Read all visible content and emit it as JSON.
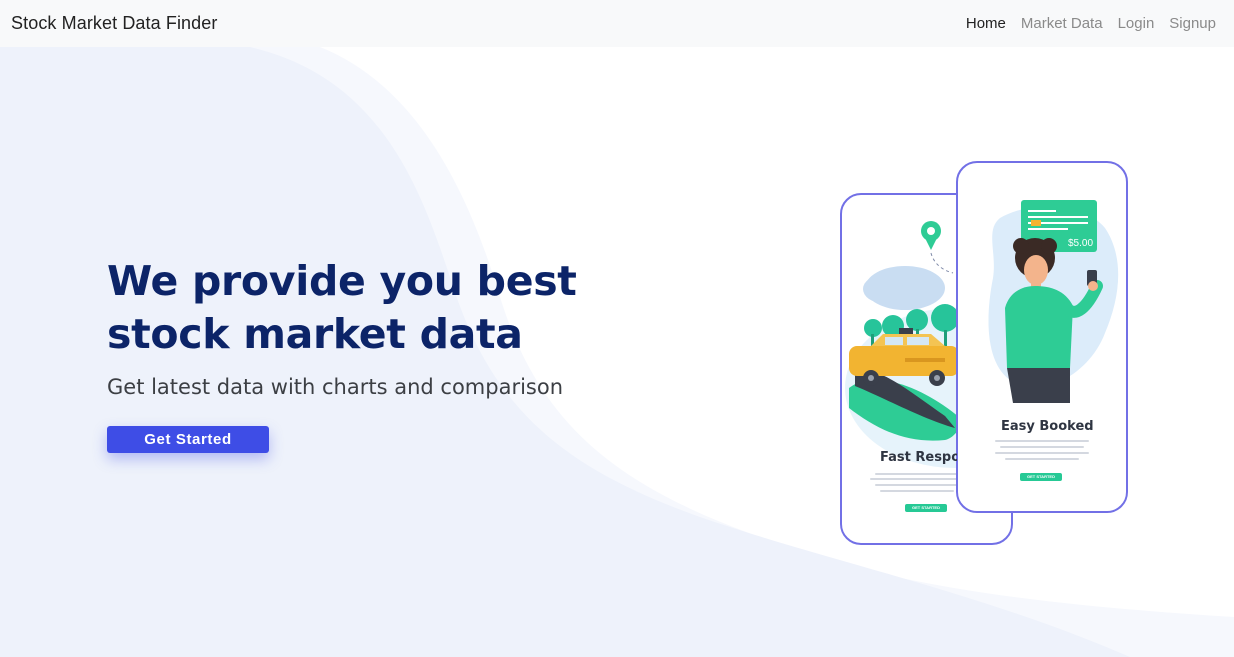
{
  "navbar": {
    "brand": "Stock Market Data Finder",
    "links": [
      {
        "label": "Home",
        "active": true
      },
      {
        "label": "Market Data",
        "active": false
      },
      {
        "label": "Login",
        "active": false
      },
      {
        "label": "Signup",
        "active": false
      }
    ]
  },
  "hero": {
    "title": "We provide you best stock market data",
    "subtitle": "Get latest data with charts and comparison",
    "cta_label": "Get Started"
  },
  "illustration": {
    "phone_back_title": "Fast Respon",
    "phone_front_title": "Easy Booked",
    "mini_button_label": "GET STARTED",
    "price": "$5.00"
  },
  "colors": {
    "brand_accent": "#3e4de6",
    "heading": "#0c2468",
    "phone_outline": "#6b6bea",
    "green": "#26c995"
  }
}
